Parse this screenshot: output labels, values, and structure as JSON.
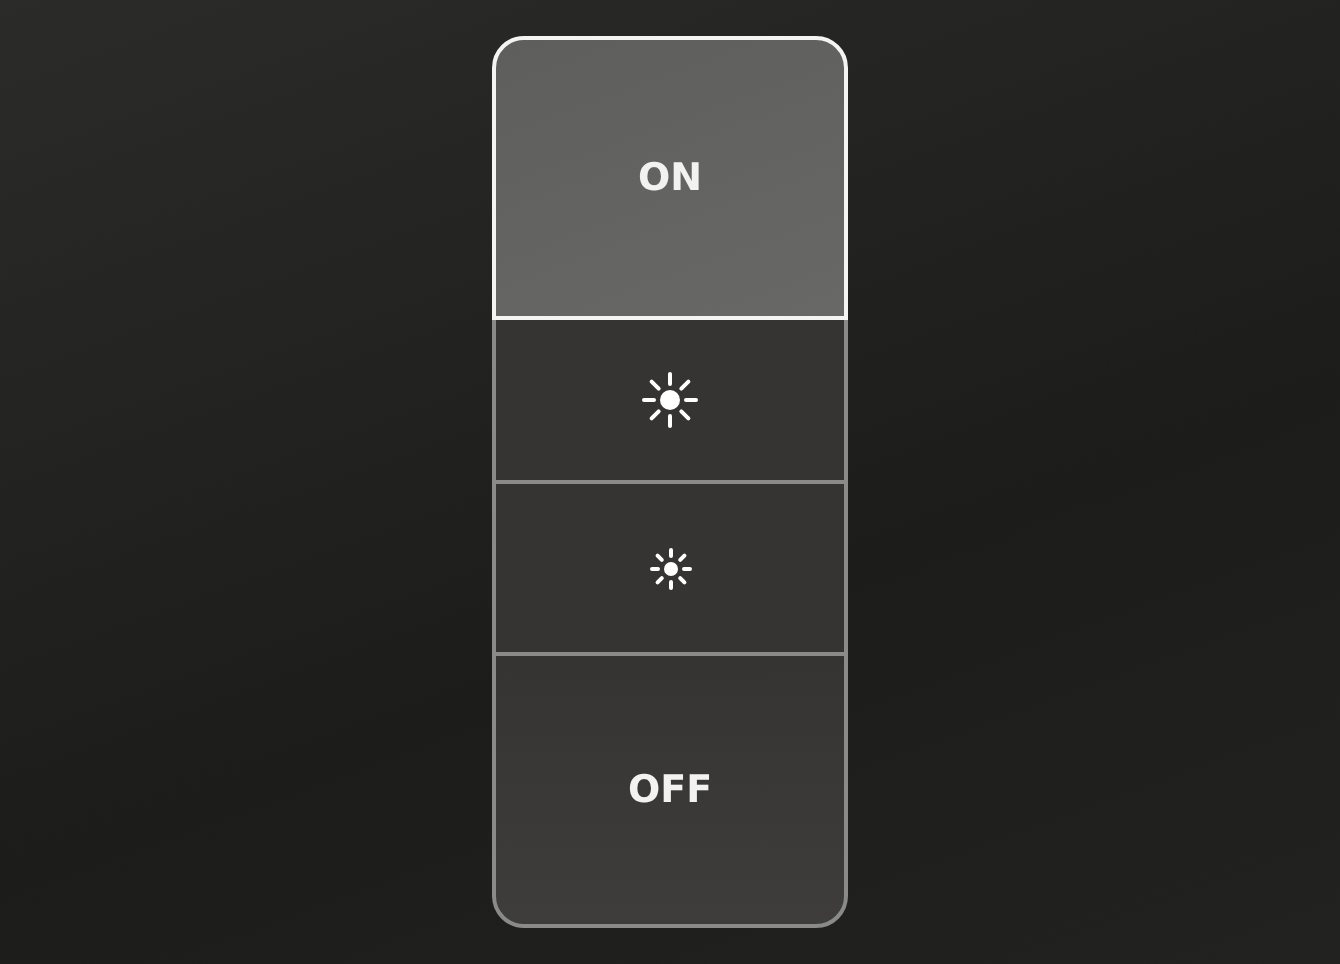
{
  "buttons": [
    {
      "kind": "text",
      "label": "ON",
      "selected": true
    },
    {
      "kind": "brighten",
      "selected": false
    },
    {
      "kind": "dim",
      "selected": false
    },
    {
      "kind": "text",
      "label": "OFF",
      "selected": false
    }
  ]
}
